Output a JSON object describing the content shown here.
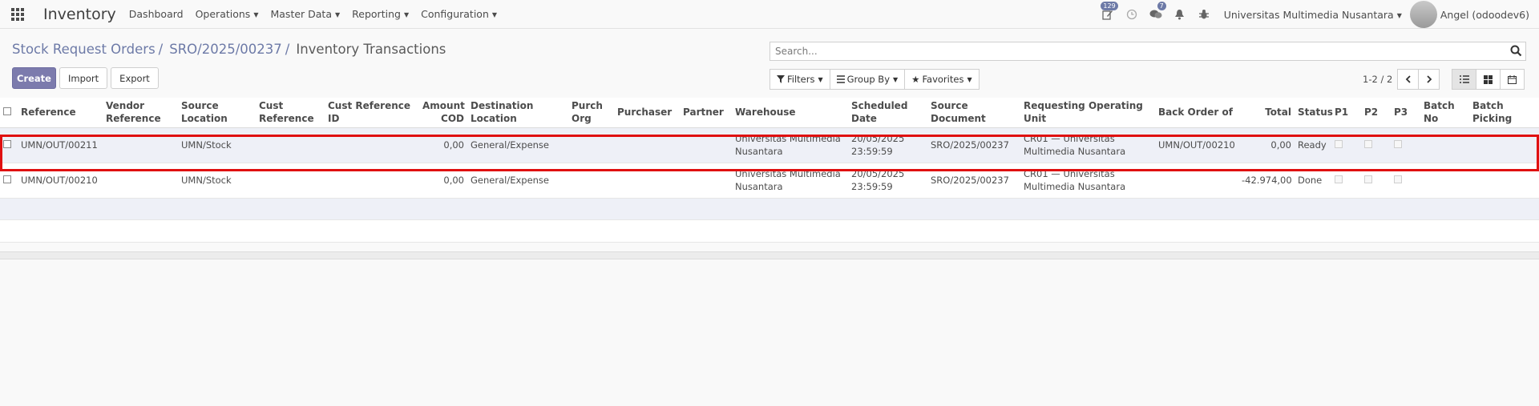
{
  "navbar": {
    "app_name": "Inventory",
    "menu": [
      {
        "label": "Dashboard",
        "dropdown": false
      },
      {
        "label": "Operations",
        "dropdown": true
      },
      {
        "label": "Master Data",
        "dropdown": true
      },
      {
        "label": "Reporting",
        "dropdown": true
      },
      {
        "label": "Configuration",
        "dropdown": true
      }
    ],
    "activity_badge": "129",
    "messages_badge": "7",
    "company": "Universitas Multimedia Nusantara",
    "user": "Angel (odoodev6)"
  },
  "breadcrumb": {
    "items": [
      "Stock Request Orders",
      "SRO/2025/00237"
    ],
    "separator": "/",
    "current": "Inventory Transactions"
  },
  "search": {
    "placeholder": "Search..."
  },
  "buttons": {
    "create": "Create",
    "import": "Import",
    "export": "Export"
  },
  "filters": {
    "filters": "Filters",
    "group_by": "Group By",
    "favorites": "Favorites"
  },
  "pager": {
    "value": "1-2 / 2"
  },
  "table": {
    "columns": [
      "Reference",
      "Vendor Reference",
      "Source Location",
      "Cust Reference",
      "Cust Reference ID",
      "Amount COD",
      "Destination Location",
      "Purch Org",
      "Purchaser",
      "Partner",
      "Warehouse",
      "Scheduled Date",
      "Source Document",
      "Requesting Operating Unit",
      "Back Order of",
      "Total",
      "Status",
      "P1",
      "P2",
      "P3",
      "Batch No",
      "Batch Picking"
    ],
    "rows": [
      {
        "reference": "UMN/OUT/00211",
        "vendor_reference": "",
        "source_location": "UMN/Stock",
        "cust_reference": "",
        "cust_reference_id": "",
        "amount_cod": "0,00",
        "destination_location": "General/Expense",
        "purch_org": "",
        "purchaser": "",
        "partner": "",
        "warehouse": "Universitas Multimedia Nusantara",
        "scheduled_date": "20/05/2025 23:59:59",
        "source_document": "SRO/2025/00237",
        "requesting_operating_unit": "CR01 — Universitas Multimedia Nusantara",
        "back_order_of": "UMN/OUT/00210",
        "total": "0,00",
        "status": "Ready"
      },
      {
        "reference": "UMN/OUT/00210",
        "vendor_reference": "",
        "source_location": "UMN/Stock",
        "cust_reference": "",
        "cust_reference_id": "",
        "amount_cod": "0,00",
        "destination_location": "General/Expense",
        "purch_org": "",
        "purchaser": "",
        "partner": "",
        "warehouse": "Universitas Multimedia Nusantara",
        "scheduled_date": "20/05/2025 23:59:59",
        "source_document": "SRO/2025/00237",
        "requesting_operating_unit": "CR01 — Universitas Multimedia Nusantara",
        "back_order_of": "",
        "total": "-42.974,00",
        "status": "Done"
      }
    ]
  },
  "colors": {
    "brand": "#7c7bad",
    "breadcrumb": "#6d7aa7",
    "highlight": "#e01010"
  }
}
